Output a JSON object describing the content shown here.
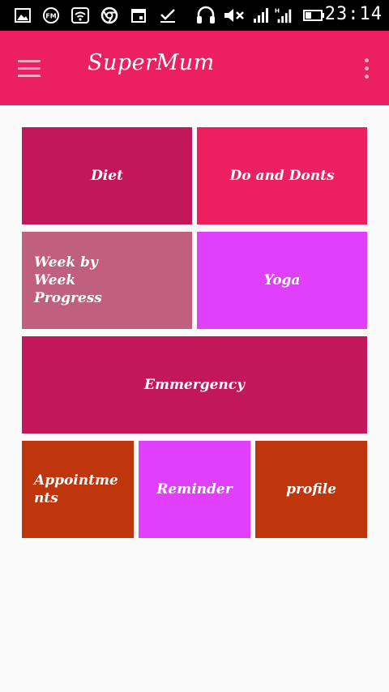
{
  "status_bar": {
    "time": "23:14",
    "icons": [
      "image-icon",
      "fm-radio-icon",
      "wifi-icon",
      "chrome-icon",
      "calendar-icon",
      "check-icon",
      "headset-icon",
      "mute-icon",
      "signal-icon",
      "signal-h-icon",
      "battery-icon"
    ]
  },
  "app_bar": {
    "title": "SuperMum",
    "color": "#ec2060"
  },
  "tiles": [
    {
      "label": "Diet",
      "color": "#c2185b"
    },
    {
      "label": "Do and Donts",
      "color": "#ec2060"
    },
    {
      "label": "Week by Week Progress",
      "color": "#c0607e"
    },
    {
      "label": "Yoga",
      "color": "#e040fb"
    },
    {
      "label": "Emmergency",
      "color": "#c2185b"
    },
    {
      "label": "Appointments",
      "color": "#bf360c"
    },
    {
      "label": "Reminder",
      "color": "#e040fb"
    },
    {
      "label": "profile",
      "color": "#bf360c"
    }
  ]
}
